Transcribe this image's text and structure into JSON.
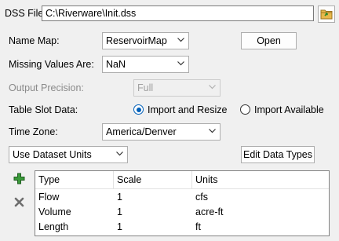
{
  "dss_file": {
    "label": "DSS File:",
    "value": "C:\\Riverware\\Init.dss"
  },
  "name_map": {
    "label": "Name Map:",
    "selected": "ReservoirMap",
    "open_button": "Open"
  },
  "missing_values": {
    "label": "Missing Values Are:",
    "selected": "NaN"
  },
  "output_precision": {
    "label": "Output Precision:",
    "selected": "Full"
  },
  "table_slot_data": {
    "label": "Table Slot Data:",
    "options": [
      "Import and Resize",
      "Import Available"
    ],
    "selected": "Import and Resize"
  },
  "time_zone": {
    "label": "Time Zone:",
    "selected": "America/Denver"
  },
  "units_mode": {
    "selected": "Use Dataset Units",
    "edit_button": "Edit Data Types"
  },
  "data_types_table": {
    "columns": [
      "Type",
      "Scale",
      "Units"
    ],
    "rows": [
      {
        "type": "Flow",
        "scale": "1",
        "units": "cfs"
      },
      {
        "type": "Volume",
        "scale": "1",
        "units": "acre-ft"
      },
      {
        "type": "Length",
        "scale": "1",
        "units": "ft"
      }
    ]
  },
  "colors": {
    "accent": "#005fb8",
    "folder": "#e8b84a",
    "add_green": "#2e8b2e",
    "delete_gray": "#6e6e6e"
  },
  "icons": {
    "browse": "folder-icon",
    "add": "plus-icon",
    "delete": "x-icon",
    "dropdown": "chevron-down-icon"
  }
}
